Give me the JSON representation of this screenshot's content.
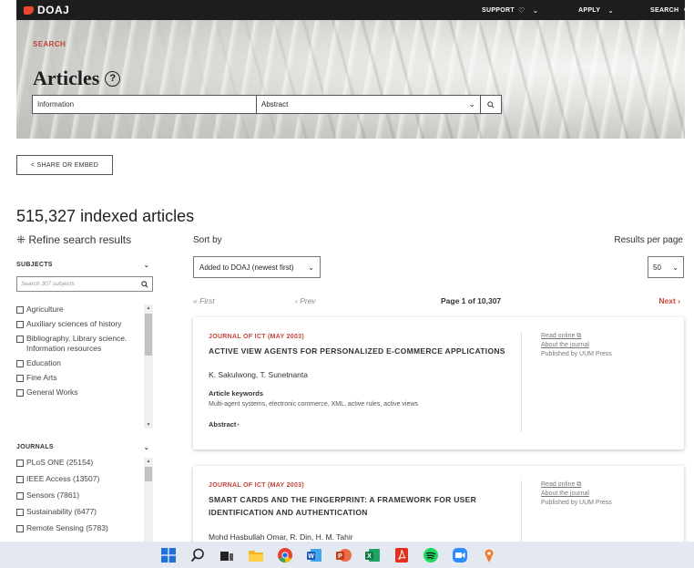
{
  "topbar": {
    "logo_text": "DOAJ",
    "support_label": "SUPPORT",
    "support_icon": "heart-icon",
    "apply_label": "APPLY",
    "search_label": "SEARCH",
    "chevron": "⌄"
  },
  "hero": {
    "section_label": "SEARCH",
    "title": "Articles",
    "help_glyph": "?",
    "search_value": "Information",
    "field_value": "Abstract",
    "field_chevron": "⌄",
    "search_button_glyph": "⚲"
  },
  "share_label": "< SHARE OR EMBED",
  "results_count": "515,327 indexed articles",
  "refine_label": "⁜ Refine search results",
  "sidebar": {
    "subjects_header": "SUBJECTS",
    "subjects_search_placeholder": "Search 307 subjects",
    "subjects": [
      "Agriculture",
      "Auxiliary sciences of history",
      "Bibliography. Library science. Information resources",
      "Education",
      "Fine Arts",
      "General Works"
    ],
    "journals_header": "JOURNALS",
    "journals": [
      "PLoS ONE (25154)",
      "IEEE Access (13507)",
      "Sensors (7861)",
      "Sustainability (6477)",
      "Remote Sensing (5783)"
    ],
    "chevron": "⌄"
  },
  "sort": {
    "label": "Sort by",
    "value": "Added to DOAJ (newest first)",
    "rpp_label": "Results per page",
    "rpp_value": "50",
    "chevron": "⌄"
  },
  "pager": {
    "first": "« First",
    "prev": "‹ Prev",
    "page": "Page 1 of 10,307",
    "next": "Next ›"
  },
  "results": [
    {
      "journal": "JOURNAL OF ICT (MAY 2003)",
      "title": "ACTIVE VIEW AGENTS FOR PERSONALIZED E-COMMERCE APPLICATIONS",
      "authors": "K. Sakulwong, T. Sunetnanta",
      "keywords_header": "Article keywords",
      "keywords": "Multi-agent systems, electronic commerce, XML, active rules, active views",
      "abstract_label": "Abstract",
      "abstract_plus": "+",
      "read_online": "Read online ⧉",
      "about_journal": "About the journal",
      "published_by": "Published by UUM Press"
    },
    {
      "journal": "JOURNAL OF ICT (MAY 2003)",
      "title": "SMART CARDS AND THE FINGERPRINT: A FRAMEWORK FOR USER IDENTIFICATION AND AUTHENTICATION",
      "authors": "Mohd Hasbullah Omar, R. Din, H. M. Tahir",
      "read_online": "Read online ⧉",
      "about_journal": "About the journal",
      "published_by": "Published by UUM Press"
    }
  ],
  "taskbar": {
    "icons": [
      "windows-start-icon",
      "search-icon",
      "task-view-icon",
      "file-explorer-icon",
      "chrome-icon",
      "word-icon",
      "powerpoint-icon",
      "excel-icon",
      "acrobat-icon",
      "spotify-icon",
      "zoom-icon",
      "figma-icon"
    ]
  },
  "colors": {
    "accent": "#c6443a",
    "topbar_bg": "#1d1d1d",
    "taskbar_bg": "#e3e8f1"
  }
}
